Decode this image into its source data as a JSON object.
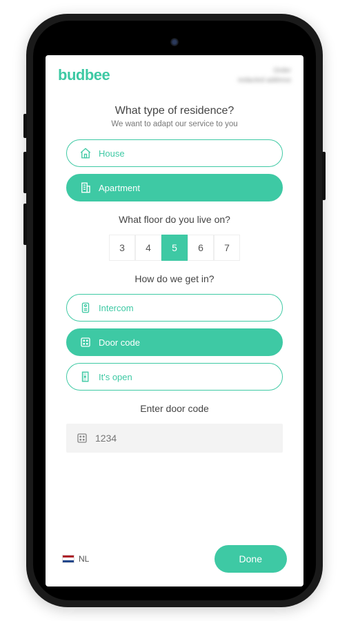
{
  "logo": "budbee",
  "header_right": {
    "line1": "Order",
    "line2": "redacted address"
  },
  "q1": {
    "title": "What type of residence?",
    "subtitle": "We want to adapt our service to you"
  },
  "residence": {
    "house": {
      "label": "House",
      "selected": false
    },
    "apartment": {
      "label": "Apartment",
      "selected": true
    }
  },
  "q2": {
    "title": "What floor do you live on?"
  },
  "floors": {
    "options": [
      "3",
      "4",
      "5",
      "6",
      "7"
    ],
    "selected": "5"
  },
  "q3": {
    "title": "How do we get in?"
  },
  "access": {
    "intercom": {
      "label": "Intercom",
      "selected": false
    },
    "doorcode": {
      "label": "Door code",
      "selected": true
    },
    "open": {
      "label": "It's open",
      "selected": false
    }
  },
  "doorcode": {
    "title": "Enter door code",
    "placeholder": "1234",
    "value": ""
  },
  "footer": {
    "lang": "NL",
    "done": "Done"
  }
}
